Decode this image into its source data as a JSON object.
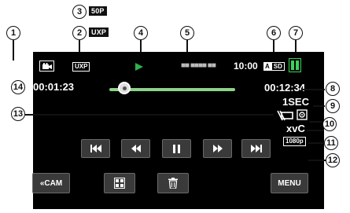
{
  "callouts": [
    "1",
    "2",
    "3",
    "4",
    "5",
    "6",
    "7",
    "8",
    "9",
    "10",
    "11",
    "12",
    "13",
    "14"
  ],
  "legend": {
    "frame_rate_chip": "50P",
    "quality_chip": "UXP"
  },
  "screen": {
    "quality_badge": "UXP",
    "date_text": "■■ ■■■■ ■■",
    "time": "10:00",
    "media_a": "A",
    "media_sd": "SD",
    "elapsed_time": "00:01:23",
    "total_time": "00:12:34",
    "interval": "1SEC",
    "video_format": "xvC",
    "resolution": "1080p",
    "progress_fraction": 0.12,
    "colors": {
      "play": "#2db24a",
      "battery": "#3bd15a",
      "slider": "#8ed28a"
    }
  },
  "controls": {
    "cam_button": "«CAM",
    "menu_button": "MENU",
    "icons": [
      "skip-back-icon",
      "rewind-icon",
      "pause-icon",
      "fast-forward-icon",
      "skip-forward-icon"
    ]
  }
}
